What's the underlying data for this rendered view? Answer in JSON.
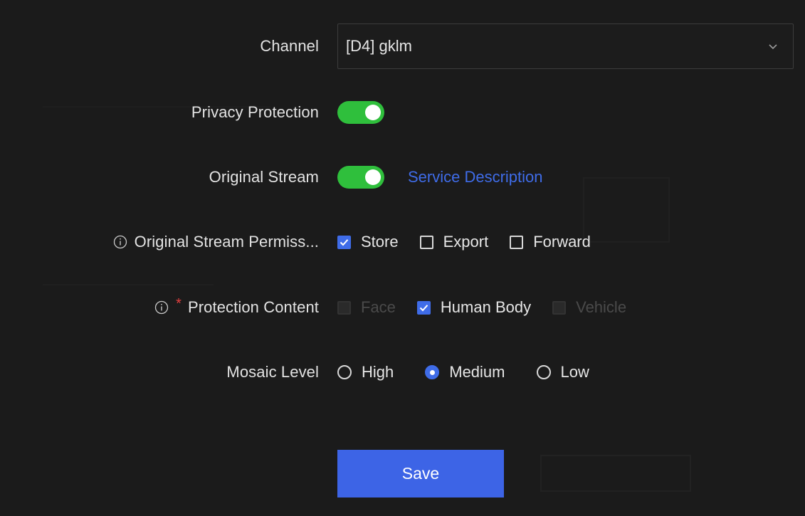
{
  "form": {
    "channel": {
      "label": "Channel",
      "value": "[D4] gklm",
      "chevron_icon": "chevron-down-icon"
    },
    "privacy_protection": {
      "label": "Privacy Protection",
      "enabled": true
    },
    "original_stream": {
      "label": "Original Stream",
      "enabled": true,
      "link_label": "Service Description"
    },
    "stream_permissions": {
      "label": "Original Stream Permiss...",
      "info_icon": "info-icon",
      "options": [
        {
          "label": "Store",
          "checked": true
        },
        {
          "label": "Export",
          "checked": false
        },
        {
          "label": "Forward",
          "checked": false
        }
      ]
    },
    "protection_content": {
      "label": "Protection Content",
      "info_icon": "info-icon",
      "required": true,
      "options": [
        {
          "label": "Face",
          "checked": false,
          "disabled": true
        },
        {
          "label": "Human Body",
          "checked": true,
          "disabled": false
        },
        {
          "label": "Vehicle",
          "checked": false,
          "disabled": true
        }
      ]
    },
    "mosaic_level": {
      "label": "Mosaic Level",
      "options": [
        {
          "label": "High",
          "selected": false
        },
        {
          "label": "Medium",
          "selected": true
        },
        {
          "label": "Low",
          "selected": false
        }
      ]
    }
  },
  "actions": {
    "save_label": "Save"
  },
  "colors": {
    "background": "#1b1b1b",
    "accent_blue": "#3f6ce8",
    "toggle_green": "#2fbf3c",
    "required_red": "#e43f3f"
  }
}
